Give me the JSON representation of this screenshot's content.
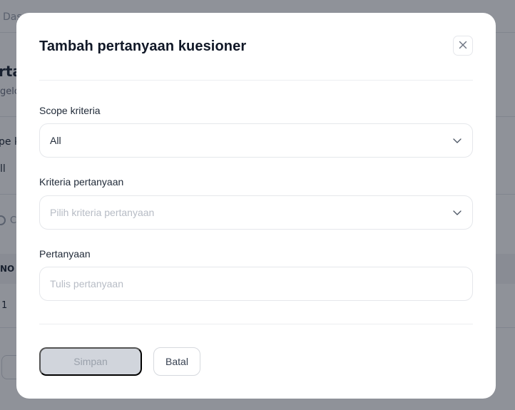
{
  "background": {
    "breadcrumb": "Das",
    "title": "rta",
    "subtitle": "gelo",
    "scope_label": "pe k",
    "scope_value": "ll",
    "search_placeholder": "C",
    "table_header_no": "NO",
    "row_number": "1"
  },
  "modal": {
    "title": "Tambah pertanyaan kuesioner",
    "close_icon": "close-icon",
    "fields": {
      "scope": {
        "label": "Scope kriteria",
        "value": "All"
      },
      "kriteria": {
        "label": "Kriteria pertanyaan",
        "placeholder": "Pilih kriteria pertanyaan"
      },
      "pertanyaan": {
        "label": "Pertanyaan",
        "placeholder": "Tulis pertanyaan"
      }
    },
    "buttons": {
      "save_label": "Simpan",
      "cancel_label": "Batal"
    }
  },
  "colors": {
    "overlay": "#8a8b8f",
    "disabled_button": "#d1d5dc",
    "placeholder_text": "#b7bcc5",
    "border": "#e5e7eb"
  }
}
